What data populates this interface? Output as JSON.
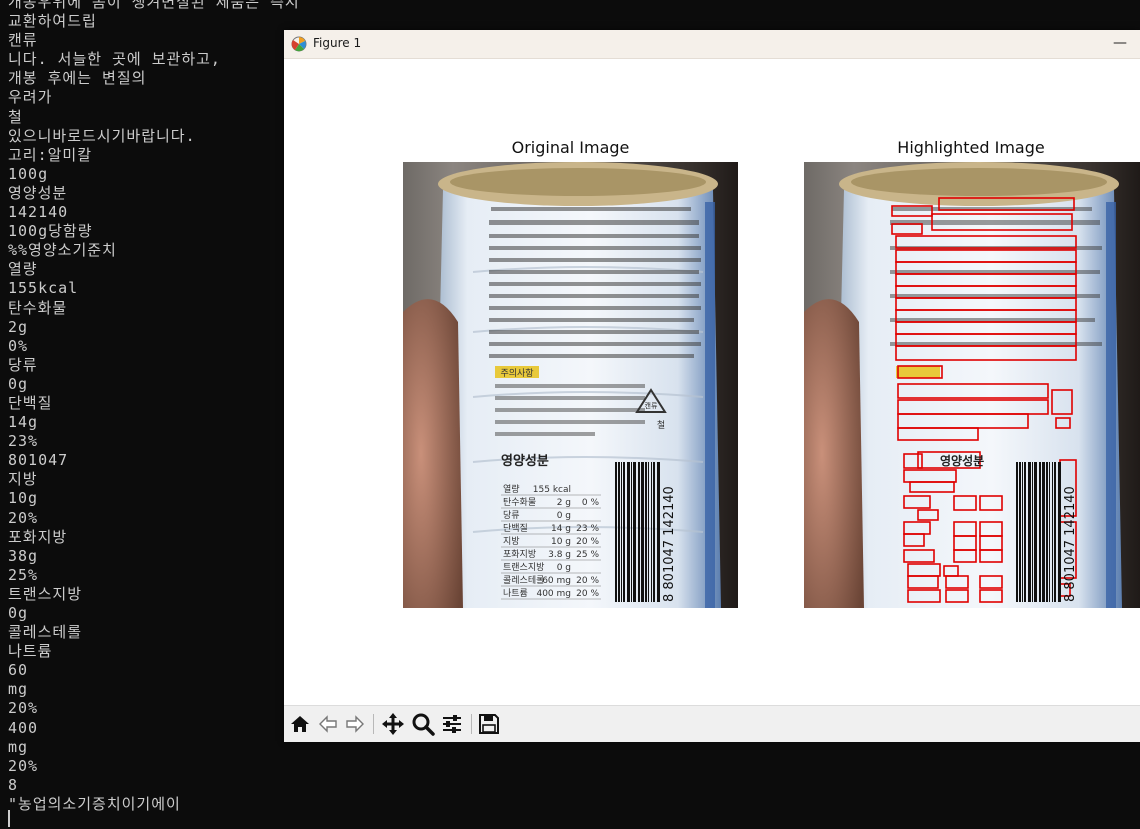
{
  "terminal": {
    "lines": [
      "개봉우위에 돔이 생겨변질된 제품은 즉시",
      "교환하여드립",
      "캔류",
      "니다. 서늘한 곳에 보관하고,",
      "개봉 후에는 변질의",
      "우려가",
      "철",
      "있으니바로드시기바랍니다.",
      "고리:알미칼",
      "100g",
      "영양성분",
      "142140",
      "100g당함량",
      "%%영양소기준치",
      "열량",
      "155kcal",
      "탄수화물",
      "2g",
      "0%",
      "당류",
      "0g",
      "단백질",
      "14g",
      "23%",
      "801047",
      "지방",
      "10g",
      "20%",
      "포화지방",
      "38g",
      "25%",
      "트랜스지방",
      "0g",
      "콜레스테롤",
      "나트륨",
      "60",
      "mg",
      "20%",
      "400",
      "mg",
      "20%",
      "8",
      "\"농업의소기증치이기에이"
    ]
  },
  "figure_window": {
    "title": "Figure 1",
    "minimize_label": "—",
    "panels": {
      "left_title": "Original Image",
      "right_title": "Highlighted Image"
    },
    "toolbar": {
      "icons": [
        "home-icon",
        "back-icon",
        "forward-icon",
        "pan-icon",
        "zoom-icon",
        "configure-subplots-icon",
        "save-icon"
      ]
    }
  },
  "label_text": {
    "section": "주의사항",
    "nutrition_header": "영양성분",
    "recycle": "캔류",
    "recycle_sub": "철",
    "barcode": "8 801047 142140",
    "hotline": "고객만족센터 : 080-589-3223(수신자요금부담)",
    "rows": [
      {
        "name": "열량",
        "amount": "155 kcal",
        "pct": ""
      },
      {
        "name": "탄수화물",
        "amount": "2 g",
        "pct": "0 %"
      },
      {
        "name": "당류",
        "amount": "0 g",
        "pct": ""
      },
      {
        "name": "단백질",
        "amount": "14 g",
        "pct": "23 %"
      },
      {
        "name": "지방",
        "amount": "10 g",
        "pct": "20 %"
      },
      {
        "name": "포화지방",
        "amount": "3.8 g",
        "pct": "25 %"
      },
      {
        "name": "트랜스지방",
        "amount": "0 g",
        "pct": ""
      },
      {
        "name": "콜레스테롤",
        "amount": "60 mg",
        "pct": "20 %"
      },
      {
        "name": "나트륨",
        "amount": "400 mg",
        "pct": "20 %"
      }
    ]
  },
  "colors": {
    "terminal_bg": "#0c0c0c",
    "terminal_fg": "#cccccc",
    "highlight_box": "#e00000"
  }
}
